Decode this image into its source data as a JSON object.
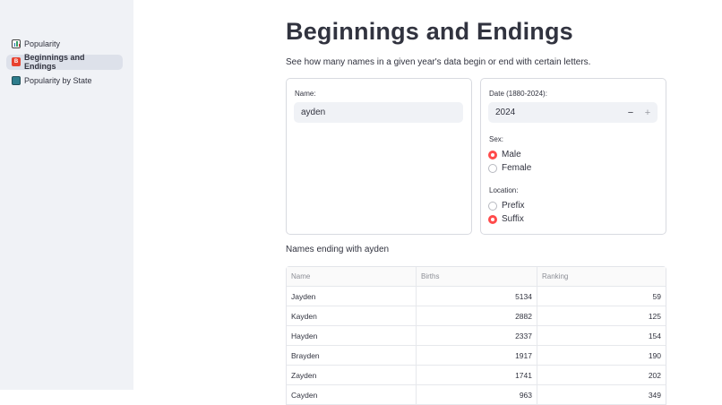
{
  "sidebar": {
    "items": [
      {
        "label": "Popularity",
        "icon": "bar-chart-icon",
        "active": false
      },
      {
        "label": "Beginnings and Endings",
        "icon": "letter-b-icon",
        "active": true
      },
      {
        "label": "Popularity by State",
        "icon": "map-icon",
        "active": false
      }
    ]
  },
  "main": {
    "title": "Beginnings and Endings",
    "subtitle": "See how many names in a given year's data begin or end with certain letters.",
    "name_field": {
      "label": "Name:",
      "value": "ayden"
    },
    "date_field": {
      "label": "Date (1880-2024):",
      "value": "2024",
      "minus": "−",
      "plus": "+"
    },
    "sex": {
      "label": "Sex:",
      "options": [
        "Male",
        "Female"
      ],
      "selected": "Male"
    },
    "location": {
      "label": "Location:",
      "options": [
        "Prefix",
        "Suffix"
      ],
      "selected": "Suffix"
    },
    "results_title": "Names ending with ayden",
    "table": {
      "columns": [
        "Name",
        "Births",
        "Ranking"
      ],
      "rows": [
        [
          "Jayden",
          "5134",
          "59"
        ],
        [
          "Kayden",
          "2882",
          "125"
        ],
        [
          "Hayden",
          "2337",
          "154"
        ],
        [
          "Brayden",
          "1917",
          "190"
        ],
        [
          "Zayden",
          "1741",
          "202"
        ],
        [
          "Cayden",
          "963",
          "349"
        ]
      ]
    }
  },
  "colors": {
    "accent": "#ff4b4b",
    "sidebar_bg": "#f0f2f6",
    "text": "#31333f"
  }
}
